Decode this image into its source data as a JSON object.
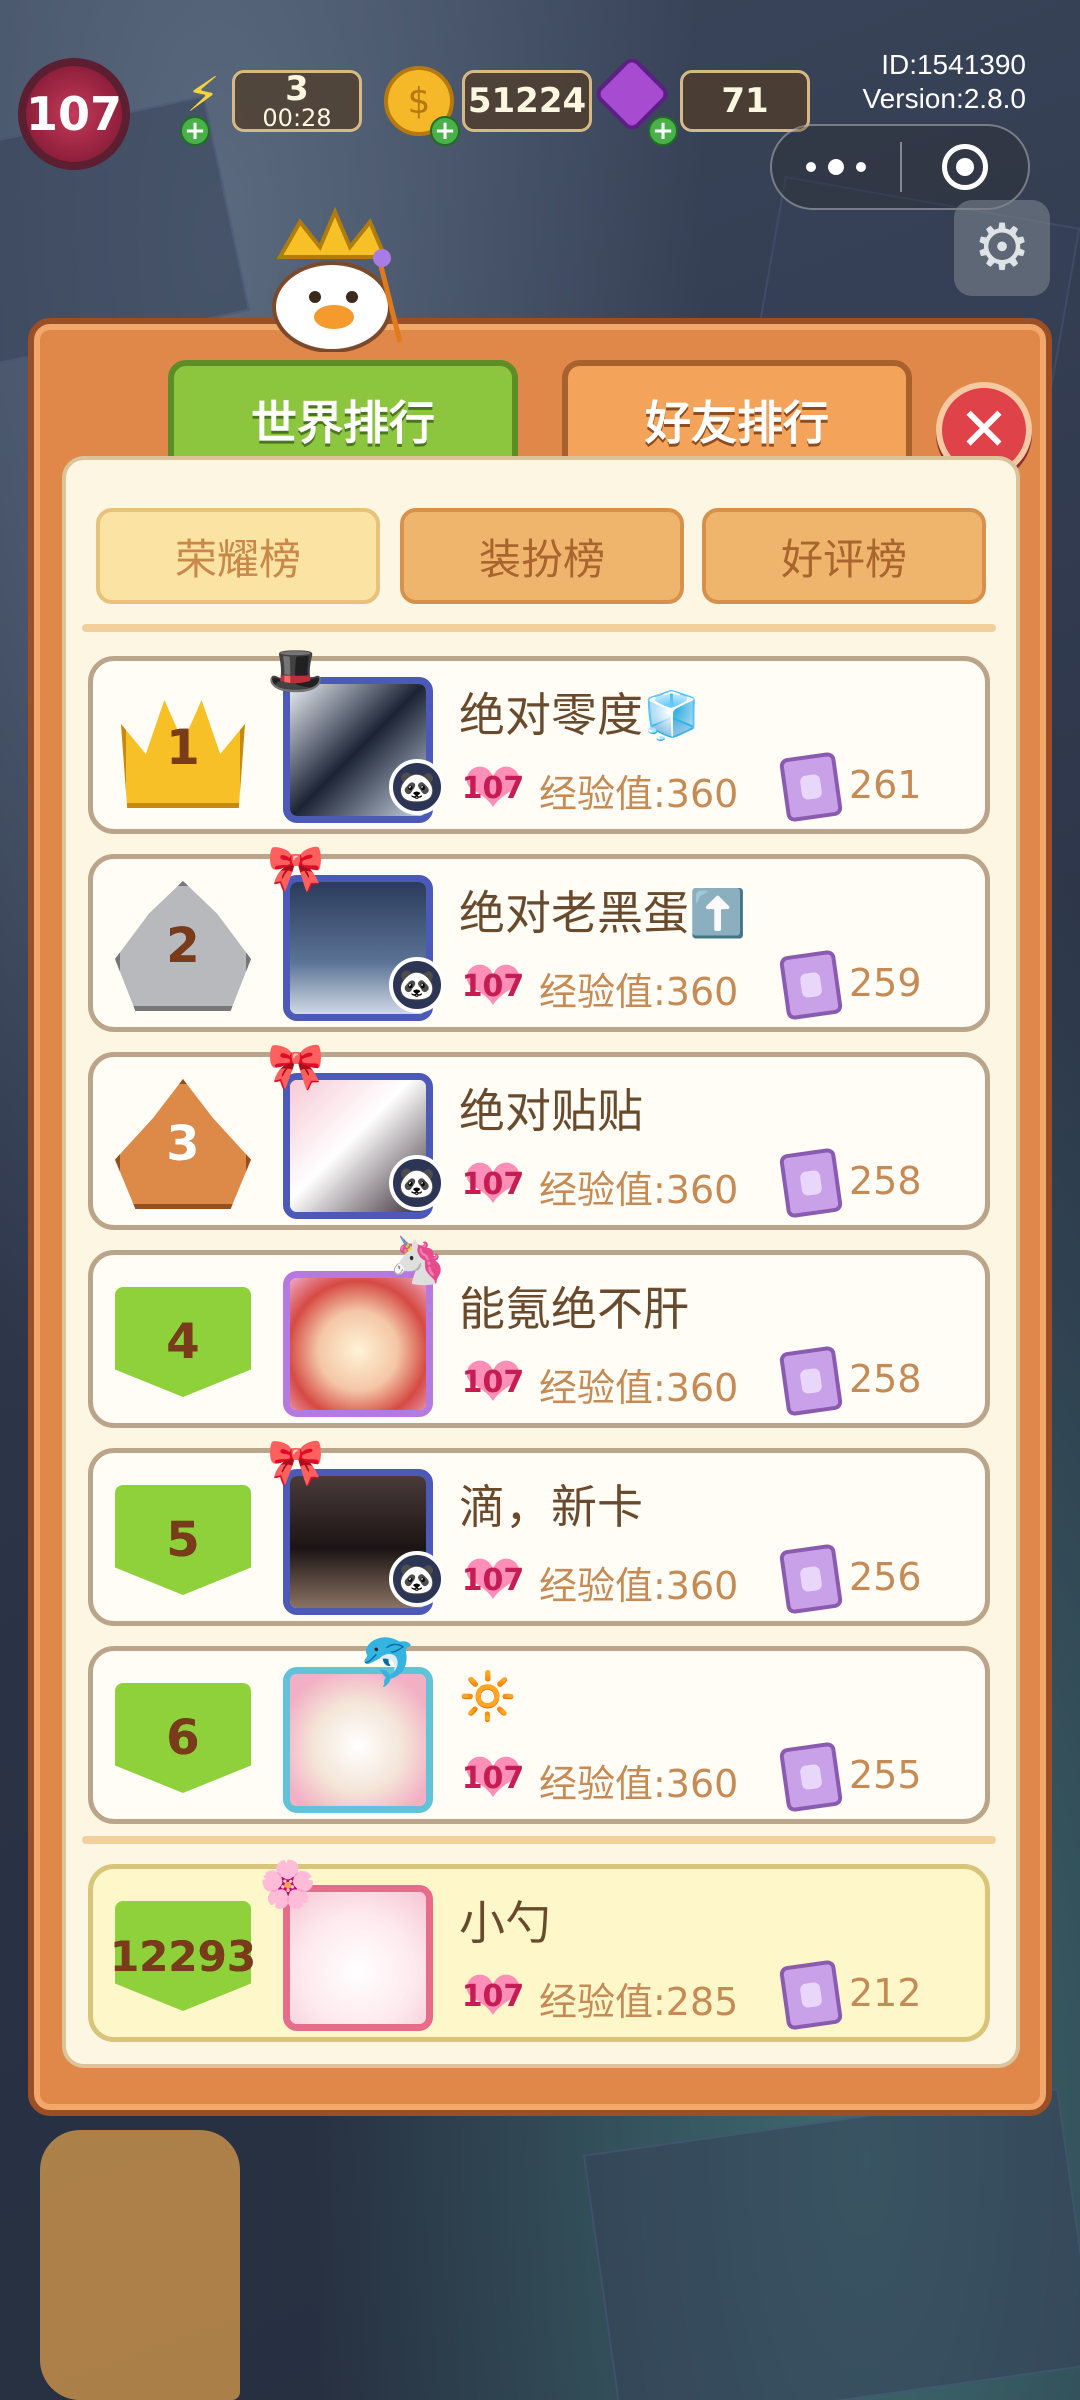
{
  "hud": {
    "level": "107",
    "energy": "3",
    "energy_timer": "00:28",
    "coins": "51224",
    "gems": "71",
    "id_text": "ID:1541390",
    "version_text": "Version:2.8.0"
  },
  "tabs": {
    "world": "世界排行",
    "friends": "好友排行"
  },
  "subtabs": [
    "荣耀榜",
    "装扮榜",
    "好评榜"
  ],
  "rows": [
    {
      "rank": "1",
      "name": "绝对零度🧊",
      "level": "107",
      "exp": "经验值:360",
      "cards": "261",
      "hat": "🎩"
    },
    {
      "rank": "2",
      "name": "绝对老黑蛋⬆️",
      "level": "107",
      "exp": "经验值:360",
      "cards": "259",
      "hat": "🎀"
    },
    {
      "rank": "3",
      "name": "绝对贴贴",
      "level": "107",
      "exp": "经验值:360",
      "cards": "258",
      "hat": "🎀"
    },
    {
      "rank": "4",
      "name": "能氪绝不肝",
      "level": "107",
      "exp": "经验值:360",
      "cards": "258",
      "hat": "🦄"
    },
    {
      "rank": "5",
      "name": "滴，新卡",
      "level": "107",
      "exp": "经验值:360",
      "cards": "256",
      "hat": "🎀"
    },
    {
      "rank": "6",
      "name": "🔆",
      "level": "107",
      "exp": "经验值:360",
      "cards": "255",
      "hat": "🐬"
    }
  ],
  "me": {
    "rank": "12293",
    "name": "小勺",
    "level": "107",
    "exp": "经验值:285",
    "cards": "212",
    "hat": "🌸"
  },
  "colors": {
    "panel": "#e0874a",
    "tab_active": "#8cc63f",
    "tab_inactive": "#f3a45a",
    "close": "#e0424a",
    "level_heart": "#ff8fb6"
  }
}
